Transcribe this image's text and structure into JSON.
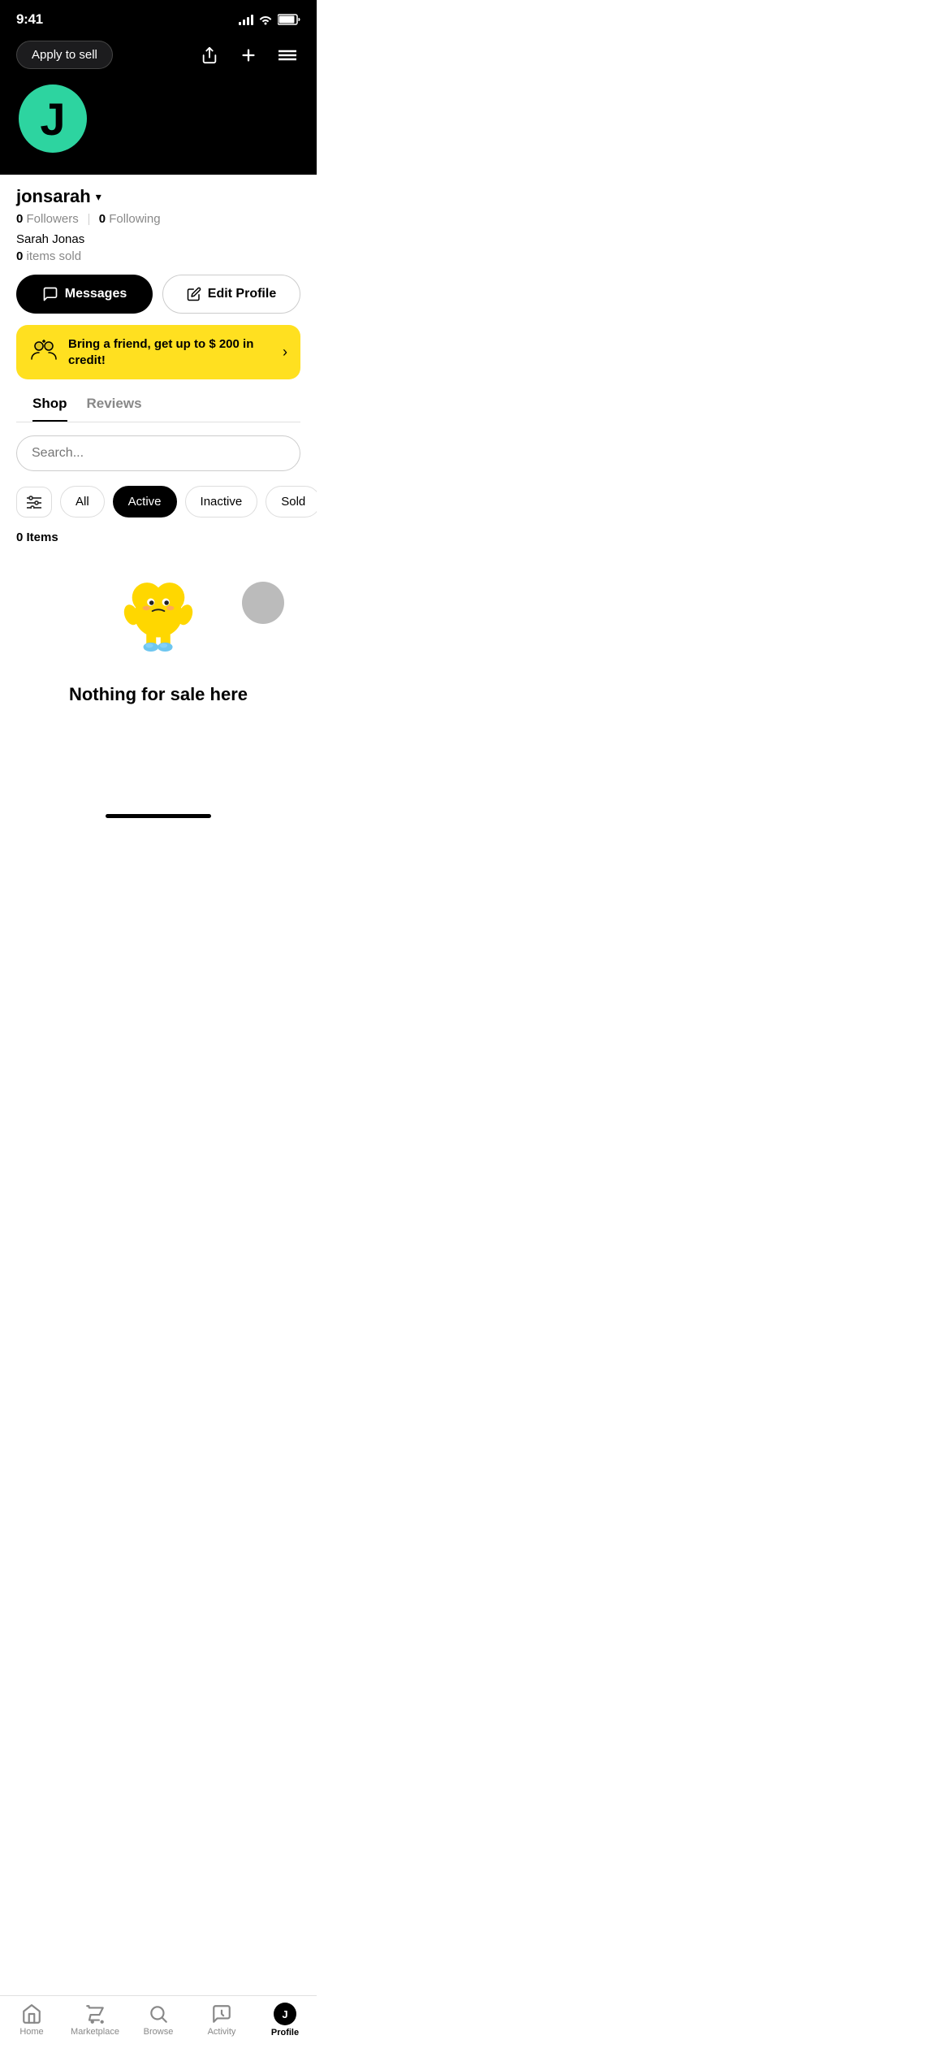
{
  "statusBar": {
    "time": "9:41"
  },
  "header": {
    "applyBtn": "Apply to sell"
  },
  "profile": {
    "avatarLetter": "J",
    "username": "jonsarah",
    "followersCount": "0",
    "followersLabel": "Followers",
    "followingCount": "0",
    "followingLabel": "Following",
    "realName": "Sarah Jonas",
    "itemsSoldCount": "0",
    "itemsSoldLabel": "items sold"
  },
  "buttons": {
    "messages": "Messages",
    "editProfile": "Edit Profile"
  },
  "referral": {
    "text": "Bring a friend, get up to $ 200 in credit!"
  },
  "tabs": [
    {
      "label": "Shop",
      "active": true
    },
    {
      "label": "Reviews",
      "active": false
    }
  ],
  "search": {
    "placeholder": "Search..."
  },
  "filters": [
    {
      "label": "All",
      "active": false
    },
    {
      "label": "Active",
      "active": true
    },
    {
      "label": "Inactive",
      "active": false
    },
    {
      "label": "Sold",
      "active": false
    }
  ],
  "itemsCount": "0 Items",
  "emptyState": {
    "title": "Nothing for sale here"
  },
  "bottomNav": [
    {
      "label": "Home",
      "active": false,
      "icon": "🏠"
    },
    {
      "label": "Marketplace",
      "active": false,
      "icon": "🏪"
    },
    {
      "label": "Browse",
      "active": false,
      "icon": "🔍"
    },
    {
      "label": "Activity",
      "active": false,
      "icon": "💬"
    },
    {
      "label": "Profile",
      "active": true,
      "icon": "👤"
    }
  ]
}
